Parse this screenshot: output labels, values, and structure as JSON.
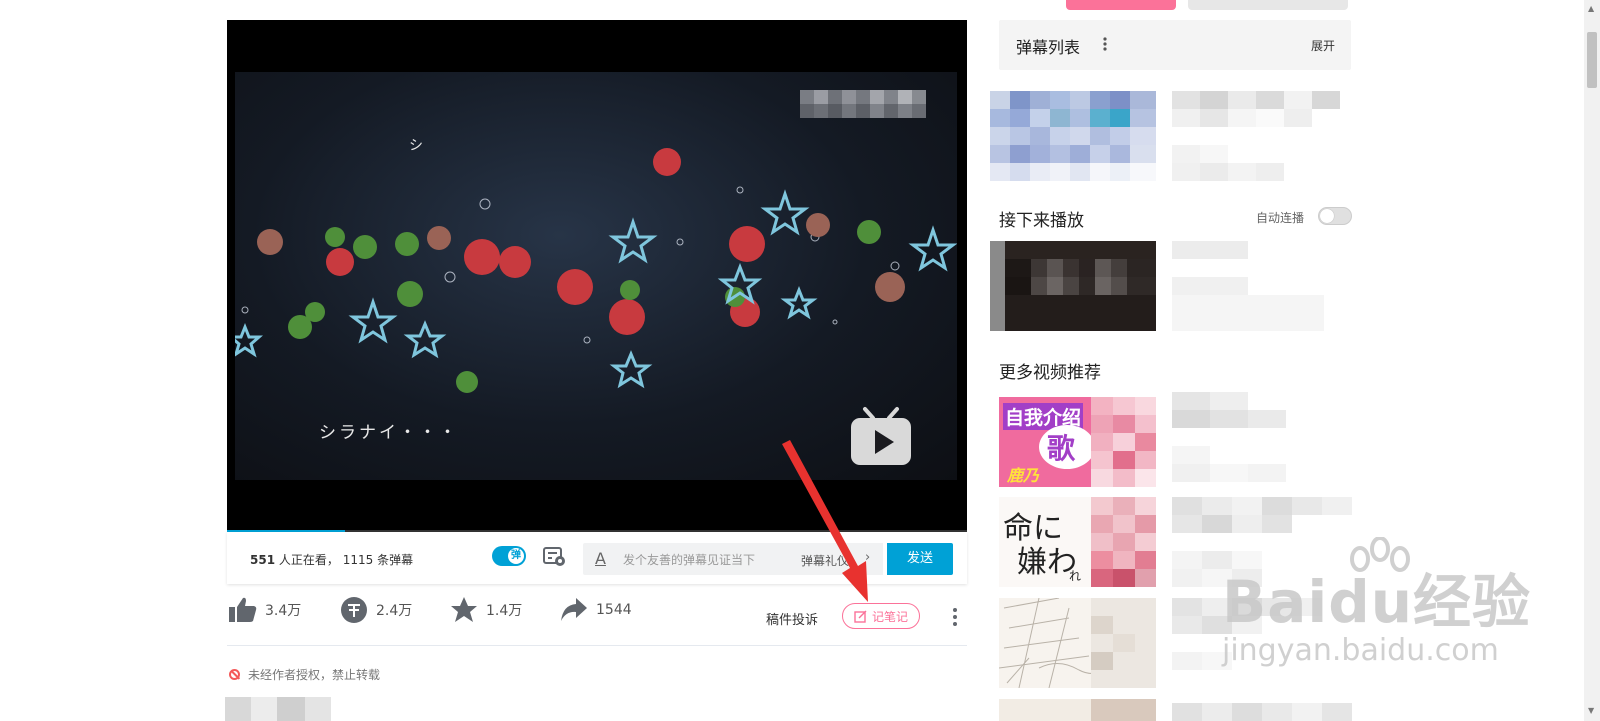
{
  "player": {
    "subtitle_top": "シ",
    "subtitle_bottom": "シラナイ・・・",
    "progress": 0.16
  },
  "controlbar": {
    "viewer_count": "551",
    "viewer_suffix": " 人正在看，",
    "danmu_count_text": "1115 条弹幕",
    "danmu_toggle_label": "弹",
    "input_placeholder": "发个友善的弹幕见证当下",
    "etiquette_label": "弹幕礼仪",
    "send_label": "发送"
  },
  "actions": {
    "like": "3.4万",
    "coin": "2.4万",
    "favorite": "1.4万",
    "share": "1544",
    "report": "稿件投诉",
    "note": "记笔记"
  },
  "copyright_notice": "未经作者授权，禁止转载",
  "sidebar": {
    "danmu_list_title": "弹幕列表",
    "danmu_list_expand": "展开",
    "next_up_title": "接下来播放",
    "autoplay_label": "自动连播",
    "recommend_title": "更多视频推荐",
    "thumb1_text1": "自我介绍",
    "thumb1_text2": "歌",
    "thumb1_text3": "鹿乃",
    "thumb2_text1": "命に",
    "thumb2_text2": "嫌わ",
    "thumb2_text3": "れ"
  },
  "watermark": {
    "main": "Baidu经验",
    "sub": "jingyan.baidu.com"
  },
  "colors": {
    "accent_blue": "#00a1d6",
    "accent_pink": "#fb7299",
    "annotation_red": "#e8322f"
  }
}
